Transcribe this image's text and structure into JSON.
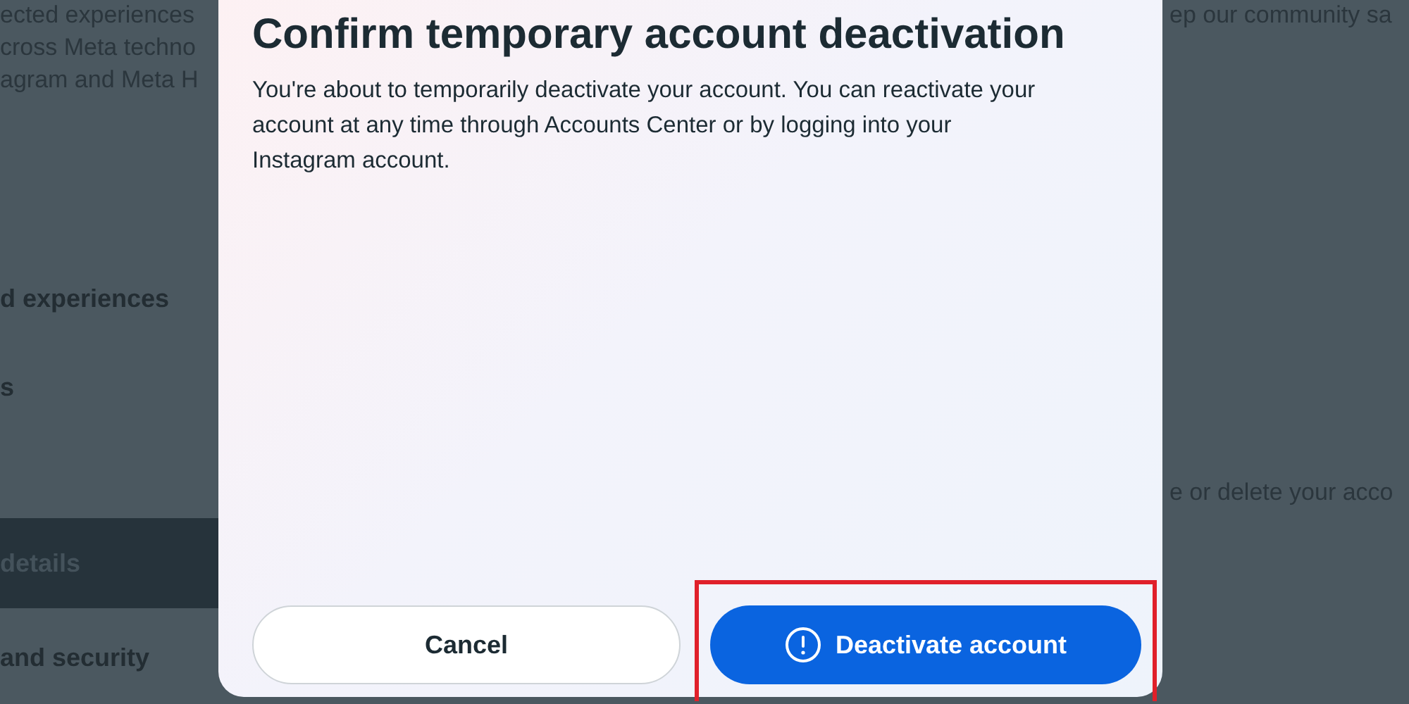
{
  "background": {
    "left_lines": [
      "ected experiences",
      "cross Meta techno",
      "agram and Meta H"
    ],
    "sidebar_items": [
      {
        "label": "d experiences",
        "selected": false
      },
      {
        "label": "s",
        "selected": false
      },
      {
        "label": "details",
        "selected": true
      },
      {
        "label": "and security",
        "selected": false
      }
    ],
    "right_lines": [
      "ep our community sa",
      "e or delete your acco"
    ]
  },
  "dialog": {
    "title": "Confirm temporary account deactivation",
    "body": "You're about to temporarily deactivate your account. You can reactivate your account at any time through Accounts Center or by logging into your Instagram account.",
    "buttons": [
      {
        "label": "Cancel",
        "kind": "secondary",
        "highlighted": false
      },
      {
        "label": "Deactivate account",
        "kind": "primary",
        "highlighted": true
      }
    ]
  }
}
